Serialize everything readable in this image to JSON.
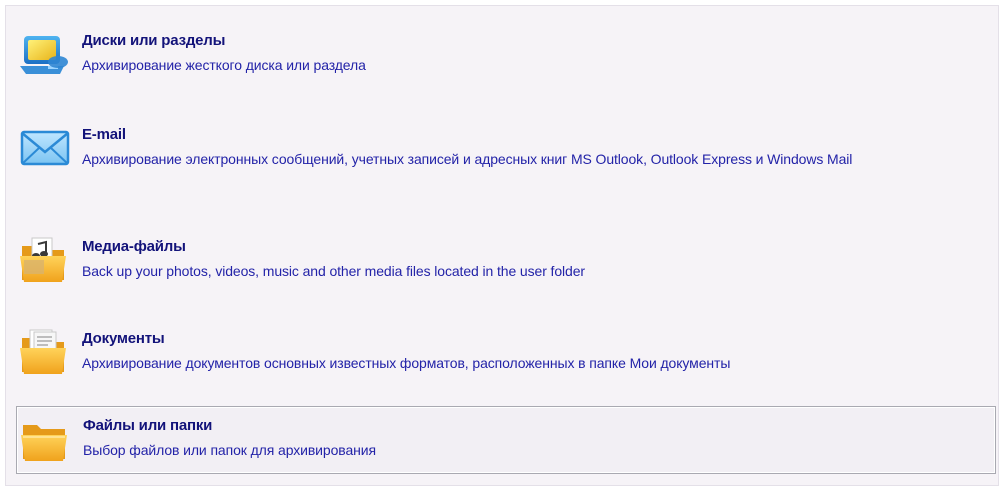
{
  "options": [
    {
      "icon": "monitor-disk-icon",
      "title": "Диски или разделы",
      "description": "Архивирование жесткого диска или раздела",
      "selected": false
    },
    {
      "icon": "envelope-icon",
      "title": "E-mail",
      "description": "Архивирование электронных сообщений, учетных записей и адресных книг MS Outlook, Outlook Express и Windows Mail",
      "selected": false
    },
    {
      "icon": "media-folder-icon",
      "title": "Медиа-файлы",
      "description": "Back up your photos, videos, music and other media files located in the user folder",
      "selected": false
    },
    {
      "icon": "documents-folder-icon",
      "title": "Документы",
      "description": "Архивирование документов основных известных форматов, расположенных в папке Мои документы",
      "selected": false
    },
    {
      "icon": "folder-icon",
      "title": "Файлы или папки",
      "description": "Выбор файлов или папок для архивирования",
      "selected": true
    }
  ],
  "colors": {
    "panel_background": "#f6f3f7",
    "title_text": "#13137a",
    "description_text": "#2323a8",
    "selection_border": "#a9a9b1"
  }
}
